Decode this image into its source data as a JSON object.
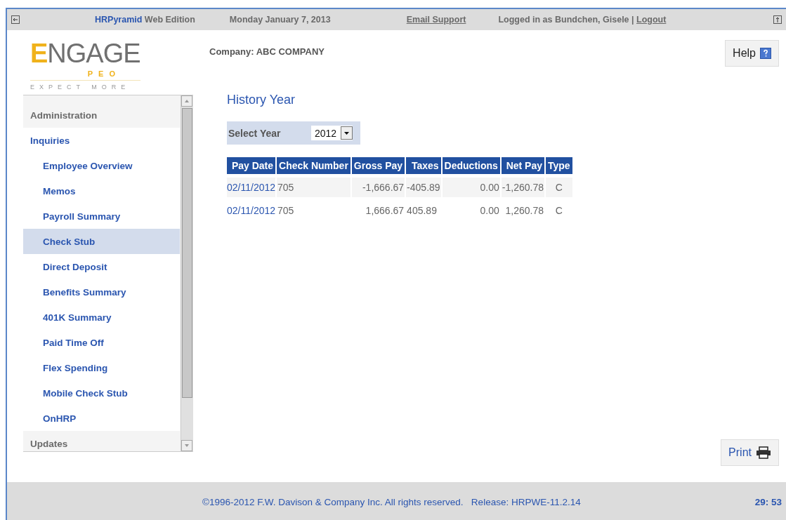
{
  "header": {
    "app_name": "HRPyramid",
    "edition": "Web Edition",
    "date": "Monday January 7, 2013",
    "support_link": "Email Support",
    "login_text": "Logged in as Bundchen, Gisele |",
    "logout_link": "Logout"
  },
  "logo": {
    "initial": "E",
    "rest": "NGAGE",
    "sub": "PEO",
    "tagline": "EXPECT MORE"
  },
  "sidebar": {
    "items": [
      {
        "label": "Administration",
        "expanded": false,
        "selected": false
      },
      {
        "label": "Inquiries",
        "expanded": true,
        "selected": false,
        "children": [
          {
            "label": "Employee Overview",
            "selected": false
          },
          {
            "label": "Memos",
            "selected": false
          },
          {
            "label": "Payroll Summary",
            "selected": false
          },
          {
            "label": "Check Stub",
            "selected": true
          },
          {
            "label": "Direct Deposit",
            "selected": false
          },
          {
            "label": "Benefits Summary",
            "selected": false
          },
          {
            "label": "401K Summary",
            "selected": false
          },
          {
            "label": "Paid Time Off",
            "selected": false
          },
          {
            "label": "Flex Spending",
            "selected": false
          },
          {
            "label": "Mobile Check Stub",
            "selected": false
          },
          {
            "label": "OnHRP",
            "selected": false
          }
        ]
      },
      {
        "label": "Updates",
        "expanded": false,
        "selected": false
      }
    ]
  },
  "company": "Company: ABC COMPANY",
  "help_button": "Help",
  "section_title": "History Year",
  "year_select": {
    "label": "Select Year",
    "value": "2012"
  },
  "table": {
    "columns": [
      "Pay Date",
      "Check Number",
      "Gross Pay",
      "Taxes",
      "Deductions",
      "Net Pay",
      "Type"
    ],
    "rows": [
      [
        "02/11/2012",
        "705",
        "-1,666.67",
        "-405.89",
        "0.00",
        "-1,260.78",
        "C"
      ],
      [
        "02/11/2012",
        "705",
        "1,666.67",
        "405.89",
        "0.00",
        "1,260.78",
        "C"
      ]
    ]
  },
  "print_button": "Print",
  "footer": {
    "copyright": "©1996-2012 F.W. Davison & Company Inc. All rights reserved.   Release: HRPWE-11.2.14",
    "timer": "29: 53"
  }
}
